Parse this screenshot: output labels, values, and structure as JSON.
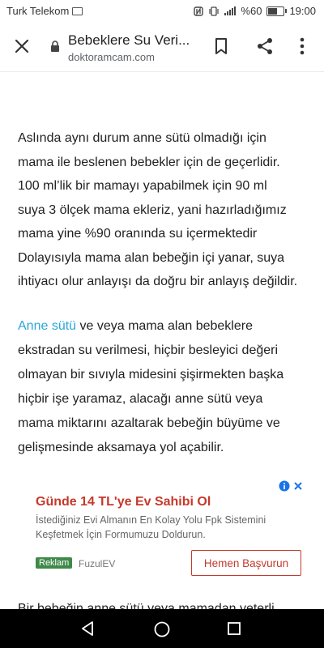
{
  "status_bar": {
    "carrier": "Turk Telekom",
    "battery_text": "%60",
    "time": "19:00",
    "icons": [
      "mail-icon",
      "nfc-icon",
      "vibrate-icon",
      "signal-icon",
      "battery-icon"
    ]
  },
  "toolbar": {
    "title": "Bebeklere Su Veri...",
    "url": "doktoramcam.com",
    "icons": [
      "close-icon",
      "lock-icon",
      "bookmark-icon",
      "share-icon",
      "more-icon"
    ]
  },
  "article": {
    "paragraph1_lines": [
      "Aslında aynı durum anne sütü olmadığı için",
      "mama ile beslenen bebekler için de geçerlidir.",
      "100 ml’lik bir mamayı yapabilmek için 90 ml",
      "suya 3 ölçek mama ekleriz, yani hazırladığımız",
      "mama yine %90 oranında su içermektedir",
      "Dolayısıyla mama alan bebeğin içi yanar, suya",
      "ihtiyacı olur anlayışı da doğru bir anlayış değildir."
    ],
    "paragraph2_link": "Anne sütü",
    "paragraph2_first_rest": " ve veya mama alan bebeklere",
    "paragraph2_lines": [
      "ekstradan su verilmesi, hiçbir besleyici değeri",
      "olmayan bir sıvıyla midesini şişirmekten başka",
      "hiçbir işe yaramaz, alacağı anne sütü veya",
      "mama miktarını azaltarak bebeğin büyüme ve",
      "gelişmesinde aksamaya yol açabilir."
    ],
    "clipped_line": "Bir bebeğin anne sütü veya mamadan yeterli"
  },
  "ad": {
    "title": "Günde 14 TL'ye Ev Sahibi Ol",
    "description": "İstediğiniz Evi Almanın En Kolay Yolu Fpk Sistemini Keşfetmek İçin Formumuzu Doldurun.",
    "badge": "Reklam",
    "source": "FuzulEV",
    "cta": "Hemen Başvurun",
    "colors": {
      "title": "#c5392b",
      "badge": "#3f8a4a",
      "cta_border": "#c23b2c",
      "choices": "#1a73e8"
    }
  },
  "nav_bar": {
    "icons": [
      "back-icon",
      "home-icon",
      "recents-icon"
    ]
  },
  "colors": {
    "link": "#2aa6d6",
    "text": "#212121",
    "nav_bg": "#000000"
  }
}
